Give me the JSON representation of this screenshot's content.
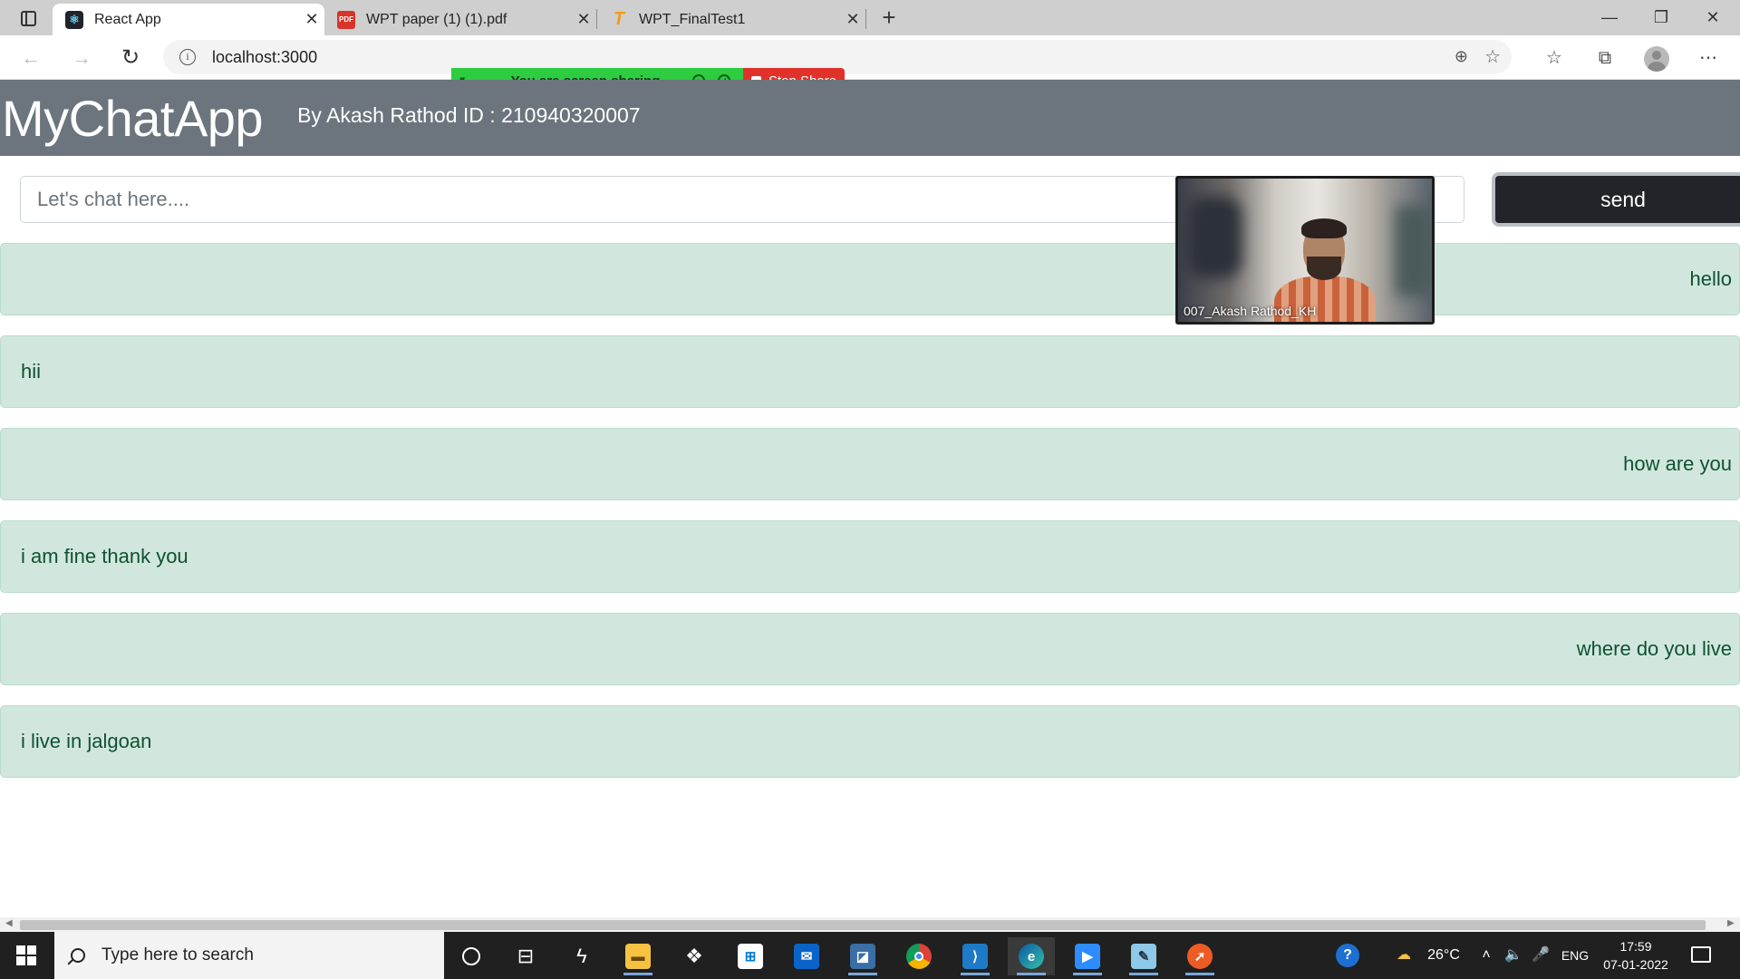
{
  "browser": {
    "tabs": [
      {
        "title": "React App",
        "active": true,
        "icon": "react-icon"
      },
      {
        "title": "WPT paper (1) (1).pdf",
        "active": false,
        "icon": "pdf-icon"
      },
      {
        "title": "WPT_FinalTest1",
        "active": false,
        "icon": "testbook-icon"
      }
    ],
    "url": "localhost:3000"
  },
  "screen_share": {
    "status": "You are screen sharing",
    "stop_label": "Stop Share"
  },
  "app": {
    "brand": "MyChatApp",
    "byline": "By Akash Rathod ID : 210940320007",
    "input_placeholder": "Let's chat here....",
    "send_label": "send",
    "messages": [
      {
        "text": "hello",
        "align": "right"
      },
      {
        "text": "hii",
        "align": "left"
      },
      {
        "text": "how are you",
        "align": "right"
      },
      {
        "text": "i am fine thank you",
        "align": "left"
      },
      {
        "text": "where do you live",
        "align": "right"
      },
      {
        "text": "i live in jalgoan",
        "align": "left"
      }
    ]
  },
  "video": {
    "participant": "007_Akash Rathod_KH"
  },
  "taskbar": {
    "search_placeholder": "Type here to search",
    "temperature": "26°C",
    "language": "ENG",
    "time": "17:59",
    "date": "07-01-2022"
  },
  "colors": {
    "header_bg": "#6c757d",
    "message_bg": "#d1e7dd",
    "message_text": "#0f5132",
    "send_bg": "#212529",
    "share_green": "#2ecc40",
    "stop_red": "#e0322a"
  }
}
